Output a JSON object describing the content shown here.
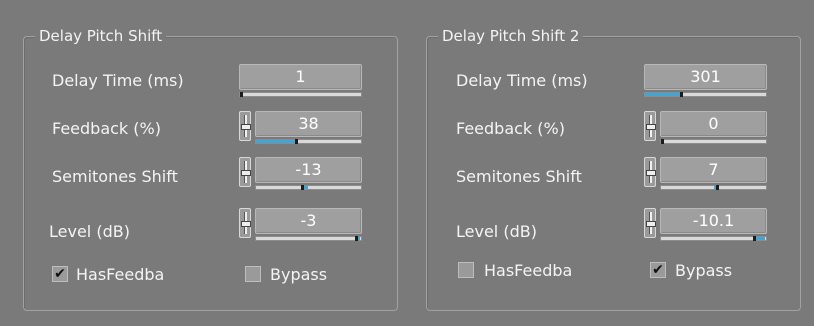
{
  "colors": {
    "background": "#7a7a7a",
    "accent_fill": "#3fa6d8"
  },
  "panels": [
    {
      "title": "Delay Pitch Shift",
      "controls": [
        {
          "label": "Delay Time (ms)",
          "value": "1",
          "slider_value": 0.01,
          "has_fader": false
        },
        {
          "label": "Feedback (%)",
          "value": "38",
          "slider_value": 0.38,
          "has_fader": true,
          "fader_icon": "fader-icon"
        },
        {
          "label": "Semitones Shift",
          "value": "-13",
          "slider_value": -0.13,
          "has_fader": true,
          "fader_icon": "fader-icon"
        },
        {
          "label": "Level (dB)",
          "value": "-3",
          "slider_value": 0.97,
          "has_fader": true,
          "fader_icon": "fader-icon"
        }
      ],
      "checkboxes": [
        {
          "label": "HasFeedba",
          "checked": true,
          "mark": "✔"
        },
        {
          "label": "Bypass",
          "checked": false,
          "mark": ""
        }
      ]
    },
    {
      "title": "Delay Pitch Shift 2",
      "controls": [
        {
          "label": "Delay Time (ms)",
          "value": "301",
          "slider_value": 0.3,
          "has_fader": false
        },
        {
          "label": "Feedback (%)",
          "value": "0",
          "slider_value": 0.0,
          "has_fader": true,
          "fader_icon": "fader-icon"
        },
        {
          "label": "Semitones Shift",
          "value": "7",
          "slider_value": 0.07,
          "has_fader": true,
          "fader_icon": "fader-icon"
        },
        {
          "label": "Level (dB)",
          "value": "-10.1",
          "slider_value": 0.9,
          "has_fader": true,
          "fader_icon": "fader-icon"
        }
      ],
      "checkboxes": [
        {
          "label": "HasFeedba",
          "checked": false,
          "mark": ""
        },
        {
          "label": "Bypass",
          "checked": true,
          "mark": "✔"
        }
      ]
    }
  ]
}
